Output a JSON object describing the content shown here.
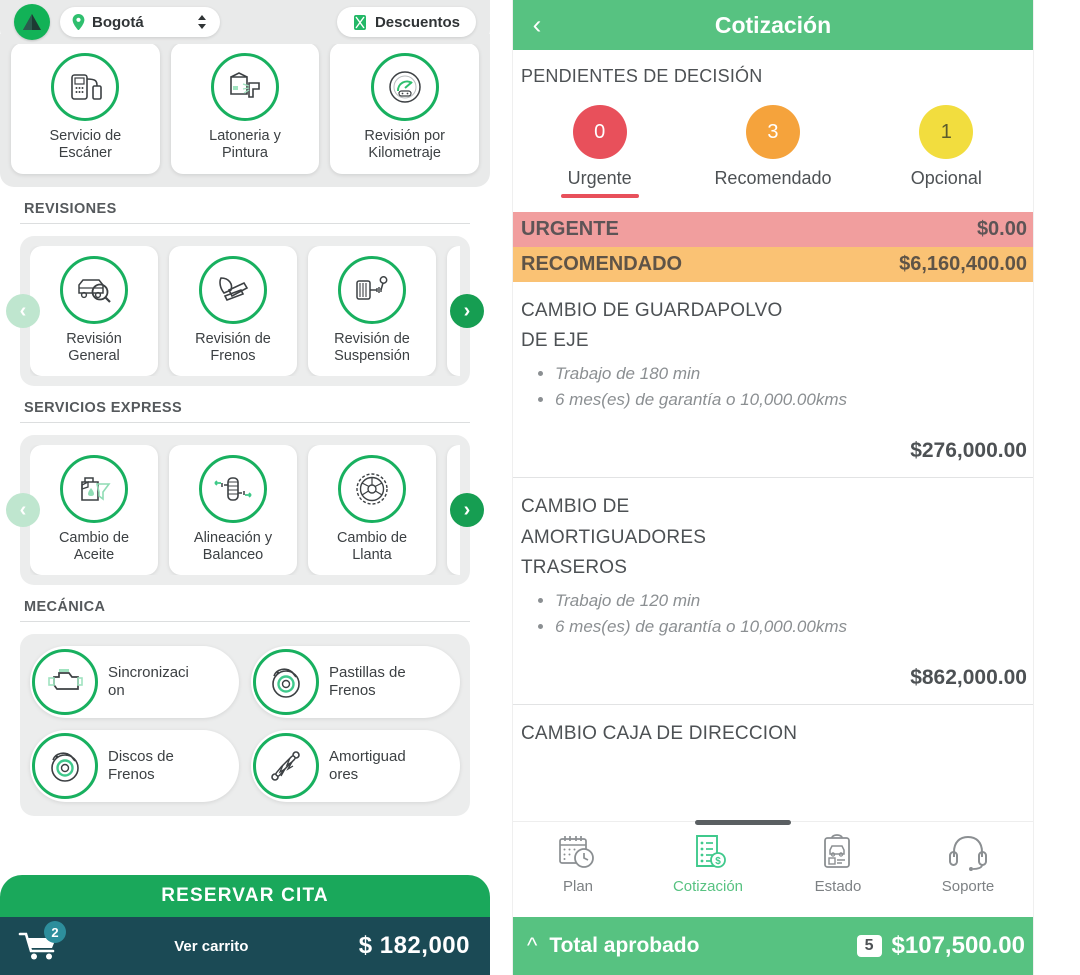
{
  "left_app": {
    "top_bar": {
      "logo_icon": "app-logo-triangle",
      "city_icon": "location-pin-icon",
      "city_value": "Bogotá",
      "city_chevron_icon": "sort-updown-icon",
      "discounts_icon": "ticket-icon",
      "discounts_label": "Descuentos"
    },
    "hero_cards": [
      {
        "icon": "scanner-device-icon",
        "label": "Servicio de\nEscáner",
        "line1": "Servicio de",
        "line2": "Escáner"
      },
      {
        "icon": "paint-spray-icon",
        "label": "Latoneria y Pintura",
        "line1": "Latoneria y",
        "line2": "Pintura"
      },
      {
        "icon": "speedometer-icon",
        "label": "Revisión por Kilometraje",
        "line1": "Revisión por",
        "line2": "Kilometraje"
      }
    ],
    "sections": [
      {
        "title": "REVISIONES",
        "prev_arrow": "chevron-left-icon",
        "next_arrow": "chevron-right-icon",
        "cards": [
          {
            "icon": "car-magnifier-icon",
            "line1": "Revisión",
            "line2": "General"
          },
          {
            "icon": "brake-pad-icon",
            "line1": "Revisión de",
            "line2": "Frenos"
          },
          {
            "icon": "suspension-icon",
            "line1": "Revisión de",
            "line2": "Suspensión"
          }
        ]
      },
      {
        "title": "SERVICIOS EXPRESS",
        "prev_arrow": "chevron-left-icon",
        "next_arrow": "chevron-right-icon",
        "cards": [
          {
            "icon": "oil-can-icon",
            "line1": "Cambio de",
            "line2": "Aceite"
          },
          {
            "icon": "wheel-alignment-icon",
            "line1": "Alineación y",
            "line2": "Balanceo"
          },
          {
            "icon": "tire-icon",
            "line1": "Cambio de",
            "line2": "Llanta"
          }
        ]
      }
    ],
    "mechanics": {
      "title": "MECÁNICA",
      "cards": [
        {
          "icon": "engine-icon",
          "line1": "Sincronizaci",
          "line2": "on"
        },
        {
          "icon": "brake-disc-icon",
          "line1": "Pastillas de",
          "line2": "Frenos"
        },
        {
          "icon": "brake-disc-icon",
          "line1": "Discos de",
          "line2": "Frenos"
        },
        {
          "icon": "shock-absorber-icon",
          "line1": "Amortiguad",
          "line2": "ores"
        }
      ]
    },
    "reserve_button": "RESERVAR CITA",
    "cart": {
      "icon": "shopping-cart-icon",
      "badge": "2",
      "label": "Ver carrito",
      "total": "$ 182,000"
    }
  },
  "right_app": {
    "header": {
      "back_icon": "chevron-left-icon",
      "title": "Cotización"
    },
    "pending_title": "PENDIENTES DE DECISIÓN",
    "tabs": [
      {
        "count": "0",
        "label": "Urgente",
        "color": "#e8505b",
        "active": true
      },
      {
        "count": "3",
        "label": "Recomendado",
        "color": "#f5a33c",
        "active": false
      },
      {
        "count": "1",
        "label": "Opcional",
        "color": "#f2dd3e",
        "active": false
      }
    ],
    "bands": [
      {
        "label": "URGENTE",
        "amount": "$0.00",
        "bg": "#f19e9e"
      },
      {
        "label": "RECOMENDADO",
        "amount": "$6,160,400.00",
        "bg": "#fac274"
      }
    ],
    "items": [
      {
        "name_line1": "CAMBIO DE GUARDAPOLVO",
        "name_line2": "DE EJE",
        "bullets": [
          "Trabajo de 180 min",
          "6 mes(es) de garantía o 10,000.00kms"
        ],
        "price": "$276,000.00"
      },
      {
        "name_line1": "CAMBIO DE",
        "name_line2": "AMORTIGUADORES",
        "name_line3": "TRASEROS",
        "bullets": [
          "Trabajo de 120 min",
          "6 mes(es) de garantía o 10,000.00kms"
        ],
        "price": "$862,000.00"
      },
      {
        "name_line1": "CAMBIO CAJA DE DIRECCION",
        "bullets": [],
        "price": ""
      }
    ],
    "bottom_nav": [
      {
        "icon": "calendar-clock-icon",
        "label": "Plan",
        "active": false
      },
      {
        "icon": "quote-document-icon",
        "label": "Cotización",
        "active": true
      },
      {
        "icon": "clipboard-car-icon",
        "label": "Estado",
        "active": false
      },
      {
        "icon": "headset-icon",
        "label": "Soporte",
        "active": false
      }
    ],
    "total_bar": {
      "chevron_icon": "chevron-up-icon",
      "label": "Total aprobado",
      "count": "5",
      "amount": "$107,500.00"
    }
  },
  "colors": {
    "brand_green": "#18b05f",
    "header_green": "#57c281",
    "urgent_red": "#e8505b",
    "recommended_orange": "#f5a33c",
    "optional_yellow": "#f2dd3e",
    "cart_dark": "#1b4a55"
  }
}
